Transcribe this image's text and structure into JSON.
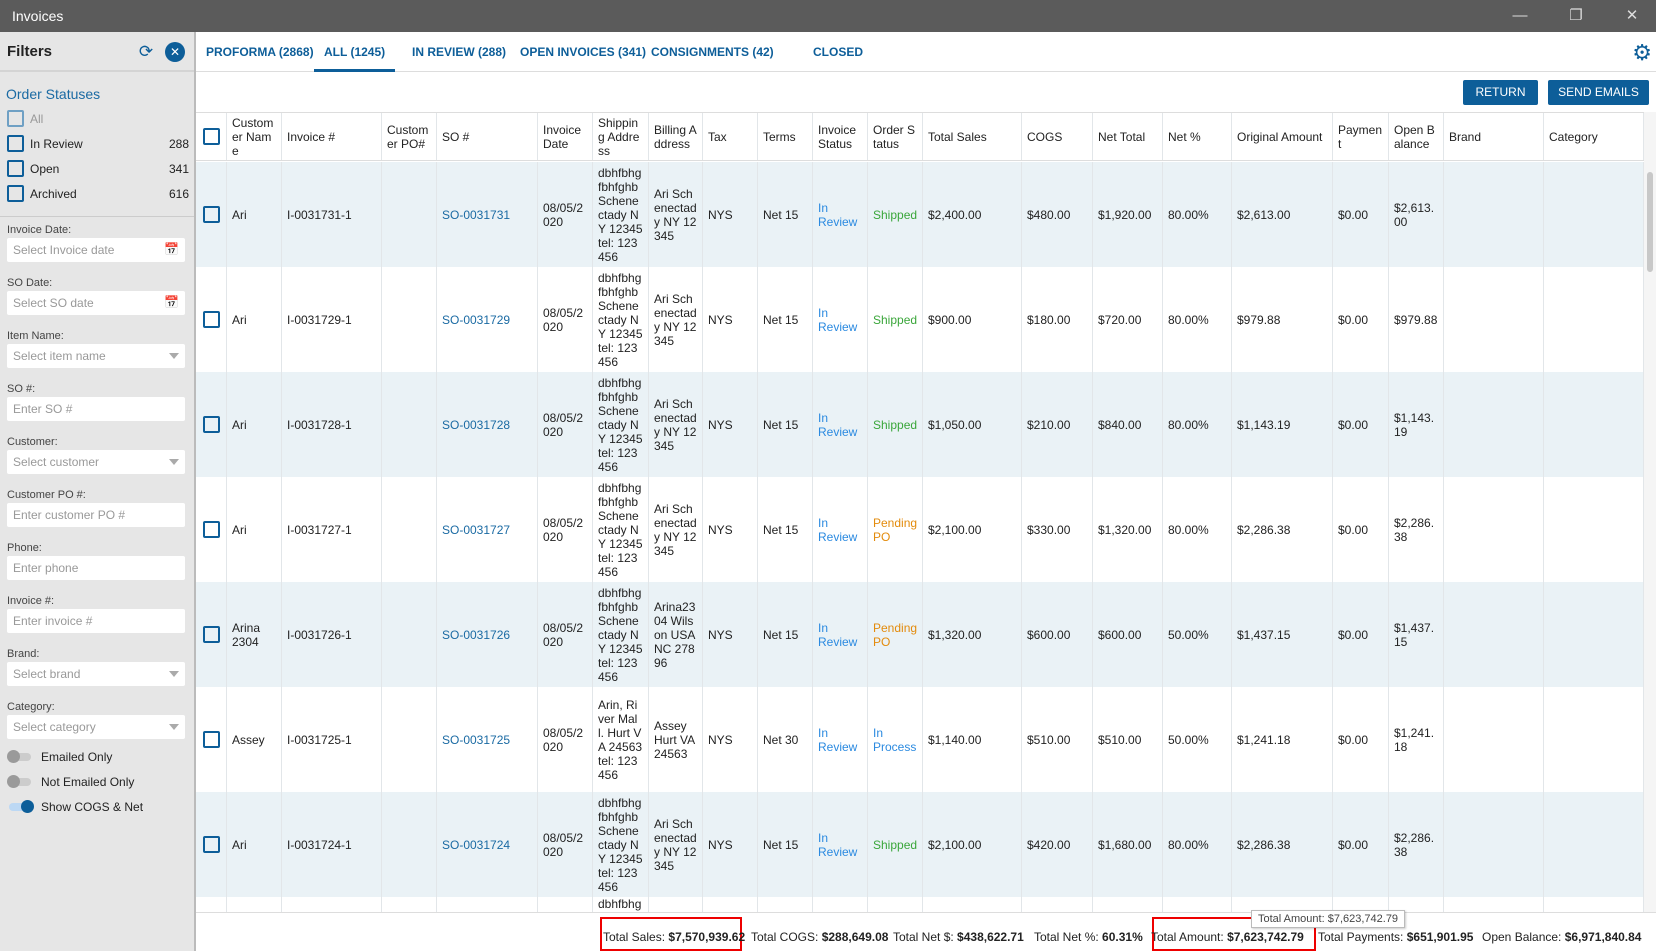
{
  "window": {
    "title": "Invoices",
    "minimize": "—",
    "restore": "❐",
    "close": "✕"
  },
  "sidebar": {
    "title": "Filters",
    "refresh_icon": "⟳",
    "close_icon": "✕",
    "order_statuses_title": "Order Statuses",
    "statuses": [
      {
        "label": "All",
        "count": ""
      },
      {
        "label": "In Review",
        "count": "288"
      },
      {
        "label": "Open",
        "count": "341"
      },
      {
        "label": "Archived",
        "count": "616"
      }
    ],
    "fields": [
      {
        "label": "Invoice Date:",
        "placeholder": "Select Invoice date",
        "kind": "date"
      },
      {
        "label": "SO Date:",
        "placeholder": "Select SO date",
        "kind": "date"
      },
      {
        "label": "Item Name:",
        "placeholder": "Select item name",
        "kind": "select"
      },
      {
        "label": "SO #:",
        "placeholder": "Enter SO #",
        "kind": "text"
      },
      {
        "label": "Customer:",
        "placeholder": "Select customer",
        "kind": "select"
      },
      {
        "label": "Customer PO #:",
        "placeholder": "Enter customer PO #",
        "kind": "text"
      },
      {
        "label": "Phone:",
        "placeholder": "Enter phone",
        "kind": "text"
      },
      {
        "label": "Invoice #:",
        "placeholder": "Enter invoice #",
        "kind": "text"
      },
      {
        "label": "Brand:",
        "placeholder": "Select brand",
        "kind": "select"
      },
      {
        "label": "Category:",
        "placeholder": "Select category",
        "kind": "select"
      }
    ],
    "toggles": [
      {
        "label": "Emailed Only",
        "on": false
      },
      {
        "label": "Not Emailed Only",
        "on": false
      },
      {
        "label": "Show COGS & Net",
        "on": true
      }
    ]
  },
  "tabs": [
    {
      "label": "PROFORMA (2868)"
    },
    {
      "label": "ALL (1245)",
      "active": true
    },
    {
      "label": "IN REVIEW (288)"
    },
    {
      "label": "OPEN INVOICES (341)"
    },
    {
      "label": "CONSIGNMENTS (42)"
    },
    {
      "label": "CLOSED"
    }
  ],
  "toolbar": {
    "return_label": "RETURN",
    "send_emails_label": "SEND EMAILS"
  },
  "table": {
    "columns": [
      "",
      "Customer Name",
      "Invoice #",
      "Customer PO#",
      "SO #",
      "Invoice Date",
      "Shipping Address",
      "Billing Address",
      "Tax",
      "Terms",
      "Invoice Status",
      "Order Status",
      "Total Sales",
      "COGS",
      "Net Total",
      "Net %",
      "Original Amount",
      "Payment",
      "Open Balance",
      "Brand",
      "Category"
    ],
    "rows": [
      [
        "",
        "Ari",
        "I-0031731-1",
        "",
        "SO-0031731",
        "08/05/2020",
        "dbhfbhg fbhfghb Schenectady NY 12345 tel: 123456",
        "Ari Schenectady NY 12345",
        "NYS",
        "Net 15",
        "In Review",
        "Shipped",
        "$2,400.00",
        "$480.00",
        "$1,920.00",
        "80.00%",
        "$2,613.00",
        "$0.00",
        "$2,613.00",
        "",
        ""
      ],
      [
        "",
        "Ari",
        "I-0031729-1",
        "",
        "SO-0031729",
        "08/05/2020",
        "dbhfbhg fbhfghb Schenectady NY 12345 tel: 123456",
        "Ari Schenectady NY 12345",
        "NYS",
        "Net 15",
        "In Review",
        "Shipped",
        "$900.00",
        "$180.00",
        "$720.00",
        "80.00%",
        "$979.88",
        "$0.00",
        "$979.88",
        "",
        ""
      ],
      [
        "",
        "Ari",
        "I-0031728-1",
        "",
        "SO-0031728",
        "08/05/2020",
        "dbhfbhg fbhfghb Schenectady NY 12345 tel: 123456",
        "Ari Schenectady NY 12345",
        "NYS",
        "Net 15",
        "In Review",
        "Shipped",
        "$1,050.00",
        "$210.00",
        "$840.00",
        "80.00%",
        "$1,143.19",
        "$0.00",
        "$1,143.19",
        "",
        ""
      ],
      [
        "",
        "Ari",
        "I-0031727-1",
        "",
        "SO-0031727",
        "08/05/2020",
        "dbhfbhg fbhfghb Schenectady NY 12345 tel: 123456",
        "Ari Schenectady NY 12345",
        "NYS",
        "Net 15",
        "In Review",
        "Pending PO",
        "$2,100.00",
        "$330.00",
        "$1,320.00",
        "80.00%",
        "$2,286.38",
        "$0.00",
        "$2,286.38",
        "",
        ""
      ],
      [
        "",
        "Arina 2304",
        "I-0031726-1",
        "",
        "SO-0031726",
        "08/05/2020",
        "dbhfbhg fbhfghb Schenectady NY 12345 tel: 123456",
        "Arina2304 Wilson USA NC 27896",
        "NYS",
        "Net 15",
        "In Review",
        "Pending PO",
        "$1,320.00",
        "$600.00",
        "$600.00",
        "50.00%",
        "$1,437.15",
        "$0.00",
        "$1,437.15",
        "",
        ""
      ],
      [
        "",
        "Assey",
        "I-0031725-1",
        "",
        "SO-0031725",
        "08/05/2020",
        "Arin, River Mall. Hurt VA 24563 tel: 123456",
        "Assey Hurt VA 24563",
        "NYS",
        "Net 30",
        "In Review",
        "In Process",
        "$1,140.00",
        "$510.00",
        "$510.00",
        "50.00%",
        "$1,241.18",
        "$0.00",
        "$1,241.18",
        "",
        ""
      ],
      [
        "",
        "Ari",
        "I-0031724-1",
        "",
        "SO-0031724",
        "08/05/2020",
        "dbhfbhg fbhfghb Schenectady NY 12345 tel: 123456",
        "Ari Schenectady NY 12345",
        "NYS",
        "Net 15",
        "In Review",
        "Shipped",
        "$2,100.00",
        "$420.00",
        "$1,680.00",
        "80.00%",
        "$2,286.38",
        "$0.00",
        "$2,286.38",
        "",
        ""
      ],
      [
        "",
        "",
        "",
        "",
        "",
        "",
        "dbhfbhg",
        "",
        "",
        "",
        "",
        "",
        "",
        "",
        "",
        "",
        "",
        "",
        "",
        "",
        ""
      ]
    ]
  },
  "footer": {
    "total_sales_label": "Total Sales:",
    "total_sales": "$7,570,939.62",
    "total_cogs_label": "Total COGS:",
    "total_cogs": "$288,649.08",
    "total_net_label": "Total Net $:",
    "total_net": "$438,622.71",
    "total_net_pct_label": "Total Net %:",
    "total_net_pct": "60.31%",
    "total_amount_label": "Total Amount:",
    "total_amount": "$7,623,742.79",
    "total_payments_label": "Total Payments:",
    "total_payments": "$651,901.95",
    "open_balance_label": "Open Balance:",
    "open_balance": "$6,971,840.84",
    "tooltip": "Total Amount: $7,623,742.79"
  },
  "colors": {
    "accent": "#0d5e99",
    "link": "#1a6aa3",
    "in_review": "#2b8ae0",
    "shipped": "#3aa63a",
    "pending": "#e38b0c",
    "highlight": "#e00000"
  }
}
